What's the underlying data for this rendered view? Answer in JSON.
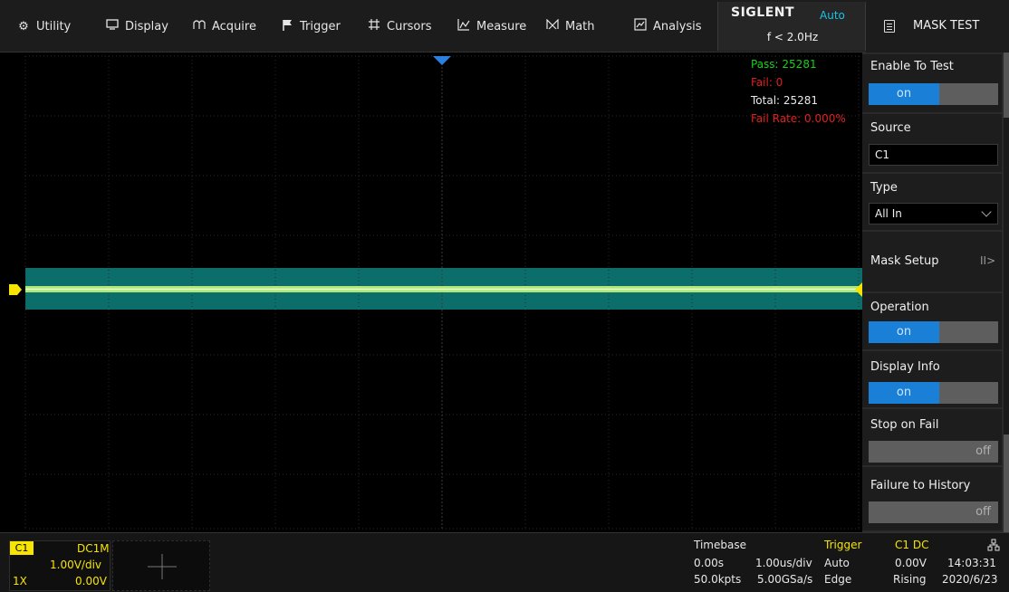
{
  "menu": {
    "utility": "Utility",
    "display": "Display",
    "acquire": "Acquire",
    "trigger": "Trigger",
    "cursors": "Cursors",
    "measure": "Measure",
    "math": "Math",
    "analysis": "Analysis"
  },
  "brand": {
    "logo": "SIGLENT",
    "mode": "Auto",
    "freq": "f < 2.0Hz"
  },
  "menu_title": "MASK TEST",
  "stats": {
    "pass": "Pass: 25281",
    "fail": "Fail: 0",
    "total": "Total: 25281",
    "fail_rate": "Fail Rate: 0.000%"
  },
  "panel": {
    "enable_to_test": {
      "label": "Enable To Test",
      "value": "on"
    },
    "source": {
      "label": "Source",
      "value": "C1"
    },
    "type": {
      "label": "Type",
      "value": "All In"
    },
    "mask_setup": {
      "label": "Mask Setup",
      "glyph": "II>"
    },
    "operation": {
      "label": "Operation",
      "value": "on"
    },
    "display_info": {
      "label": "Display Info",
      "value": "on"
    },
    "stop_on_fail": {
      "label": "Stop on Fail",
      "value": "off"
    },
    "failure_to_history": {
      "label": "Failure to History",
      "value": "off"
    }
  },
  "channel": {
    "name": "C1",
    "coupling": "DC1M",
    "scale": "1.00V/div",
    "probe": "1X",
    "offset": "0.00V"
  },
  "timebase": {
    "label": "Timebase",
    "delay": "0.00s",
    "scale": "1.00us/div",
    "memory": "50.0kpts",
    "sample_rate": "5.00GSa/s"
  },
  "trigger": {
    "label": "Trigger",
    "mode": "Auto",
    "type": "Edge",
    "source": "C1 DC",
    "level": "0.00V",
    "slope": "Rising"
  },
  "clock": {
    "time": "14:03:31",
    "date": "2020/6/23"
  },
  "colors": {
    "accent": "#1a7fd6",
    "pass": "#19d019",
    "fail": "#e02020",
    "channel1": "#f7e400",
    "mask": "#0b6e6a",
    "brand_mode": "#19c3e6",
    "trigger_label": "#f7e400"
  },
  "icons": {
    "utility": "gear-icon",
    "display": "monitor-icon",
    "acquire": "acquire-icon",
    "trigger": "flag-icon",
    "cursors": "cursors-icon",
    "measure": "measure-icon",
    "math": "math-icon",
    "analysis": "analysis-icon",
    "menu_title": "document-icon",
    "network": "network-icon"
  }
}
